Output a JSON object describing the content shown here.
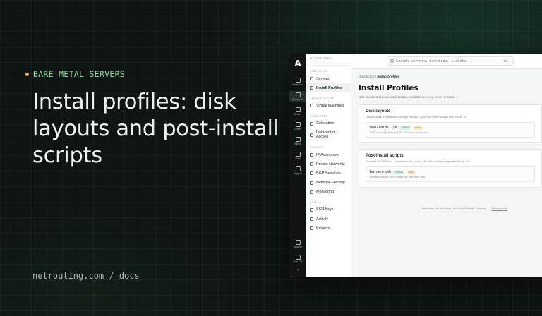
{
  "hero": {
    "eyebrow": "BARE METAL SERVERS",
    "headline": "Install profiles: disk layouts and post-install scripts",
    "footer": "netrouting.com / docs"
  },
  "colors": {
    "accent_green": "#8fdca5",
    "accent_orange": "#f0a94b",
    "background": "#0f1513"
  },
  "app": {
    "logo": "A",
    "rail": [
      {
        "label": "Dashboard",
        "icon": "dashboard-icon"
      },
      {
        "label": "Datacenter",
        "icon": "datacenter-icon",
        "active": true
      },
      {
        "label": "Orders",
        "icon": "cart-icon"
      },
      {
        "label": "Orders",
        "icon": "box-icon"
      },
      {
        "label": "Billing",
        "icon": "billing-icon"
      },
      {
        "label": "Stats",
        "icon": "stats-icon"
      },
      {
        "label": "Support",
        "icon": "support-icon"
      }
    ],
    "rail_bottom": [
      {
        "label": "Account",
        "icon": "user-icon"
      },
      {
        "label": "Sign Out",
        "icon": "sign-out-icon"
      }
    ],
    "nav": {
      "brand": "DATACENTER",
      "sections": [
        {
          "heading": "BARE METAL",
          "items": [
            {
              "label": "Servers",
              "icon": "server-icon"
            },
            {
              "label": "Install Profiles",
              "icon": "profile-icon",
              "active": true
            }
          ]
        },
        {
          "heading": "CLOUD COMPUTE",
          "items": [
            {
              "label": "Virtual Machines",
              "icon": "vm-icon"
            }
          ]
        },
        {
          "heading": "COLOCATION",
          "items": [
            {
              "label": "Colocation",
              "icon": "colocation-icon"
            },
            {
              "label": "Datacenter Access",
              "icon": "key-icon"
            }
          ]
        },
        {
          "heading": "NETWORK",
          "items": [
            {
              "label": "IP Addresses",
              "icon": "ip-icon"
            },
            {
              "label": "Private Networks",
              "icon": "network-icon"
            },
            {
              "label": "BGP Sessions",
              "icon": "bgp-icon"
            },
            {
              "label": "Network Security",
              "icon": "shield-icon"
            },
            {
              "label": "Monitoring",
              "icon": "pulse-icon"
            }
          ]
        },
        {
          "heading": "ACCESS",
          "items": [
            {
              "label": "SSH Keys",
              "icon": "ssh-key-icon"
            },
            {
              "label": "Activity",
              "icon": "activity-icon"
            },
            {
              "label": "Projects",
              "icon": "folder-icon"
            }
          ]
        }
      ]
    },
    "search": {
      "placeholder": "Search servers, invoices, tickets...",
      "shortcut": "⌘K"
    },
    "breadcrumb": {
      "root": "Dashboard",
      "current": "install-profiles"
    },
    "page": {
      "title": "Install Profiles",
      "subtitle": "Disk layouts and post-install scripts, available on every server reinstall."
    },
    "cards": [
      {
        "title": "Disk layouts",
        "desc": "How the disks are partitioned during a reinstall — pick one on the reinstall form. Plural: 1/5",
        "item": {
          "name": "web-raid1-lvm",
          "badge1": "TOSHIO",
          "badge2": "privacy",
          "meta": "RAID1 across both disks, LVM, 80% root + rest on /var"
        }
      },
      {
        "title": "Post-install scripts",
        "desc": "Run after the OS boots — bootstrap roles, harden SSH, wire config management. Plural: 1/5",
        "item": {
          "name": "harden-ssh",
          "badge1": "TOSHIO",
          "badge2": "config",
          "meta": "Disable password login, rotate keys, lock down sshd"
        }
      }
    ],
    "footer": {
      "text": "Netrouting · by Netrouting · An Erbus Holdings Company",
      "link": "Privacy policy"
    }
  }
}
